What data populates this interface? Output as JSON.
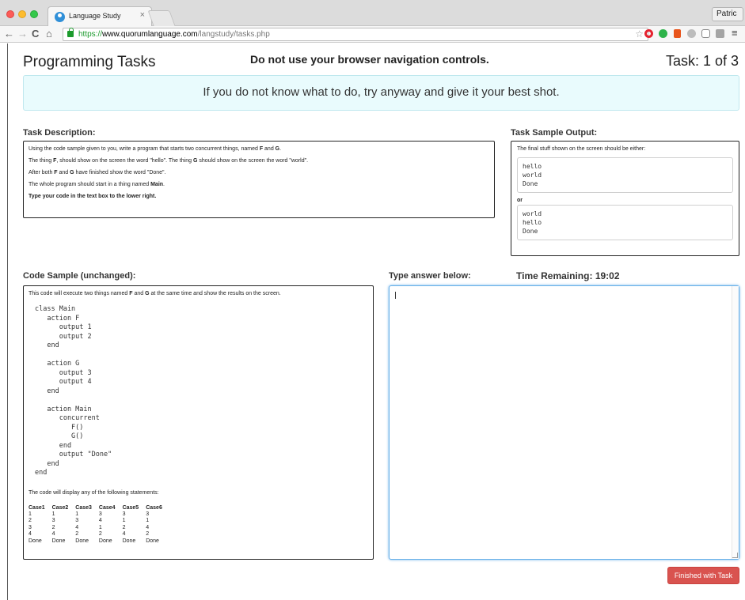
{
  "browser": {
    "tab_title": "Language Study",
    "tab_close": "×",
    "user_button": "Patric",
    "url_scheme": "https://",
    "url_host": "www.quorumlanguage.com",
    "url_path": "/langstudy/tasks.php",
    "back_glyph": "←",
    "forward_glyph": "→",
    "reload_glyph": "C",
    "home_glyph": "⌂",
    "star_glyph": "☆",
    "menu_glyph": "≡"
  },
  "header": {
    "title": "Programming Tasks",
    "warning": "Do not use your browser navigation controls.",
    "task_counter": "Task: 1 of 3"
  },
  "hint": "If you do not know what to do, try anyway and give it your best shot.",
  "task_description": {
    "label": "Task Description:",
    "p1_pre": "Using the code sample given to you, write a program that starts two concurrent things, named ",
    "p1_f": "F",
    "p1_and": " and ",
    "p1_g": "G",
    "p1_end": ".",
    "p2_pre": "The thing ",
    "p2_f": "F",
    "p2_mid": ", should show on the screen the word \"hello\". The thing ",
    "p2_g": "G",
    "p2_end": " should show on the screen the word \"world\".",
    "p3_pre": "After both ",
    "p3_f": "F",
    "p3_and": " and ",
    "p3_g": "G",
    "p3_end": " have finished show the word \"Done\".",
    "p4_pre": "The whole program should start in a thing named ",
    "p4_main": "Main",
    "p4_end": ".",
    "p5": "Type your code in the text box to the lower right."
  },
  "sample_output": {
    "label": "Task Sample Output:",
    "intro": "The final stuff shown on the screen should be either:",
    "option1": "hello\nworld\nDone",
    "or": "or",
    "option2": "world\nhello\nDone"
  },
  "code_sample": {
    "label": "Code Sample (unchanged):",
    "intro_pre": "This code will execute two things named ",
    "intro_f": "F",
    "intro_and": " and ",
    "intro_g": "G",
    "intro_end": " at the same time and show the results on the screen.",
    "code": "class Main\n   action F\n      output 1\n      output 2\n   end\n\n   action G\n      output 3\n      output 4\n   end\n\n   action Main\n      concurrent\n         F()\n         G()\n      end\n      output \"Done\"\n   end\nend",
    "outro": "The code will display any of the following statements:",
    "case_headers": [
      "Case1",
      "Case2",
      "Case3",
      "Case4",
      "Case5",
      "Case6"
    ],
    "case_rows": [
      [
        "1",
        "1",
        "1",
        "3",
        "3",
        "3"
      ],
      [
        "2",
        "3",
        "3",
        "4",
        "1",
        "1"
      ],
      [
        "3",
        "2",
        "4",
        "1",
        "2",
        "4"
      ],
      [
        "4",
        "4",
        "2",
        "2",
        "4",
        "2"
      ],
      [
        "Done",
        "Done",
        "Done",
        "Done",
        "Done",
        "Done"
      ]
    ]
  },
  "answer": {
    "label": "Type answer below:",
    "value": ""
  },
  "timer": {
    "label": "Time Remaining:",
    "value": "19:02"
  },
  "finish_button": "Finished with Task",
  "colors": {
    "accent_button": "#d9534f",
    "hint_background": "#e9fbfd",
    "focus_border": "#66afe9"
  }
}
